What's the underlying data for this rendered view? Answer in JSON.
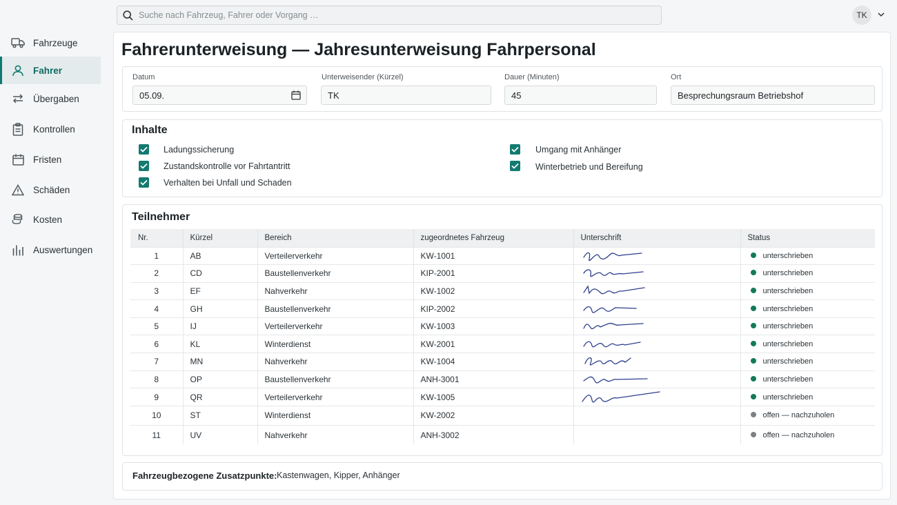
{
  "sidebar": {
    "items": [
      {
        "label": "Fahrzeuge",
        "icon": "truck-icon",
        "active": false
      },
      {
        "label": "Fahrer",
        "icon": "user-icon",
        "active": true
      },
      {
        "label": "Übergaben",
        "icon": "swap-arrows-icon",
        "active": false
      },
      {
        "label": "Kontrollen",
        "icon": "clipboard-icon",
        "active": false
      },
      {
        "label": "Fristen",
        "icon": "calendar-icon",
        "active": false
      },
      {
        "label": "Schäden",
        "icon": "warning-icon",
        "active": false
      },
      {
        "label": "Kosten",
        "icon": "coins-icon",
        "active": false
      },
      {
        "label": "Auswertungen",
        "icon": "bar-chart-icon",
        "active": false
      }
    ]
  },
  "topbar": {
    "search_placeholder": "Suche nach Fahrzeug, Fahrer oder Vorgang …",
    "avatar_initials": "TK"
  },
  "page": {
    "title": "Fahrerunterweisung — Jahresunterweisung Fahrpersonal"
  },
  "meta": {
    "datum_label": "Datum",
    "datum_value": "05.09.",
    "unterweisender_label": "Unterweisender (Kürzel)",
    "unterweisender_value": "TK",
    "dauer_label": "Dauer (Minuten)",
    "dauer_value": "45",
    "ort_label": "Ort",
    "ort_value": "Besprechungsraum Betriebshof"
  },
  "inhalte": {
    "title": "Inhalte",
    "items": [
      {
        "label": "Ladungssicherung",
        "checked": true
      },
      {
        "label": "Zustandskontrolle vor Fahrtantritt",
        "checked": true
      },
      {
        "label": "Verhalten bei Unfall und Schaden",
        "checked": true
      },
      {
        "label": "Umgang mit Anhänger",
        "checked": true
      },
      {
        "label": "Winterbetrieb und Bereifung",
        "checked": true
      }
    ]
  },
  "teilnehmer": {
    "title": "Teilnehmer",
    "columns": [
      "Nr.",
      "Kürzel",
      "Bereich",
      "zugeordnetes Fahrzeug",
      "Unterschrift",
      "Status"
    ],
    "rows": [
      {
        "nr": "1",
        "kuerzel": "AB",
        "bereich": "Verteilerverkehr",
        "fahrzeug": "KW-1001",
        "signed": true,
        "status": "unterschrieben"
      },
      {
        "nr": "2",
        "kuerzel": "CD",
        "bereich": "Baustellenverkehr",
        "fahrzeug": "KIP-2001",
        "signed": true,
        "status": "unterschrieben"
      },
      {
        "nr": "3",
        "kuerzel": "EF",
        "bereich": "Nahverkehr",
        "fahrzeug": "KW-1002",
        "signed": true,
        "status": "unterschrieben"
      },
      {
        "nr": "4",
        "kuerzel": "GH",
        "bereich": "Baustellenverkehr",
        "fahrzeug": "KIP-2002",
        "signed": true,
        "status": "unterschrieben"
      },
      {
        "nr": "5",
        "kuerzel": "IJ",
        "bereich": "Verteilerverkehr",
        "fahrzeug": "KW-1003",
        "signed": true,
        "status": "unterschrieben"
      },
      {
        "nr": "6",
        "kuerzel": "KL",
        "bereich": "Winterdienst",
        "fahrzeug": "KW-2001",
        "signed": true,
        "status": "unterschrieben"
      },
      {
        "nr": "7",
        "kuerzel": "MN",
        "bereich": "Nahverkehr",
        "fahrzeug": "KW-1004",
        "signed": true,
        "status": "unterschrieben"
      },
      {
        "nr": "8",
        "kuerzel": "OP",
        "bereich": "Baustellenverkehr",
        "fahrzeug": "ANH-3001",
        "signed": true,
        "status": "unterschrieben"
      },
      {
        "nr": "9",
        "kuerzel": "QR",
        "bereich": "Verteilerverkehr",
        "fahrzeug": "KW-1005",
        "signed": true,
        "status": "unterschrieben"
      },
      {
        "nr": "10",
        "kuerzel": "ST",
        "bereich": "Winterdienst",
        "fahrzeug": "KW-2002",
        "signed": false,
        "status": "offen — nachzuholen"
      },
      {
        "nr": "11",
        "kuerzel": "UV",
        "bereich": "Nahverkehr",
        "fahrzeug": "ANH-3002",
        "signed": false,
        "status": "offen — nachzuholen"
      }
    ]
  },
  "zusatz": {
    "label": "Fahrzeugbezogene Zusatzpunkte:",
    "value": "Kastenwagen, Kipper, Anhänger"
  },
  "colors": {
    "accent": "#0f7a6f",
    "status_signed": "#137a5a",
    "status_open": "#7b8185",
    "signature_ink": "#2c3e8c"
  }
}
